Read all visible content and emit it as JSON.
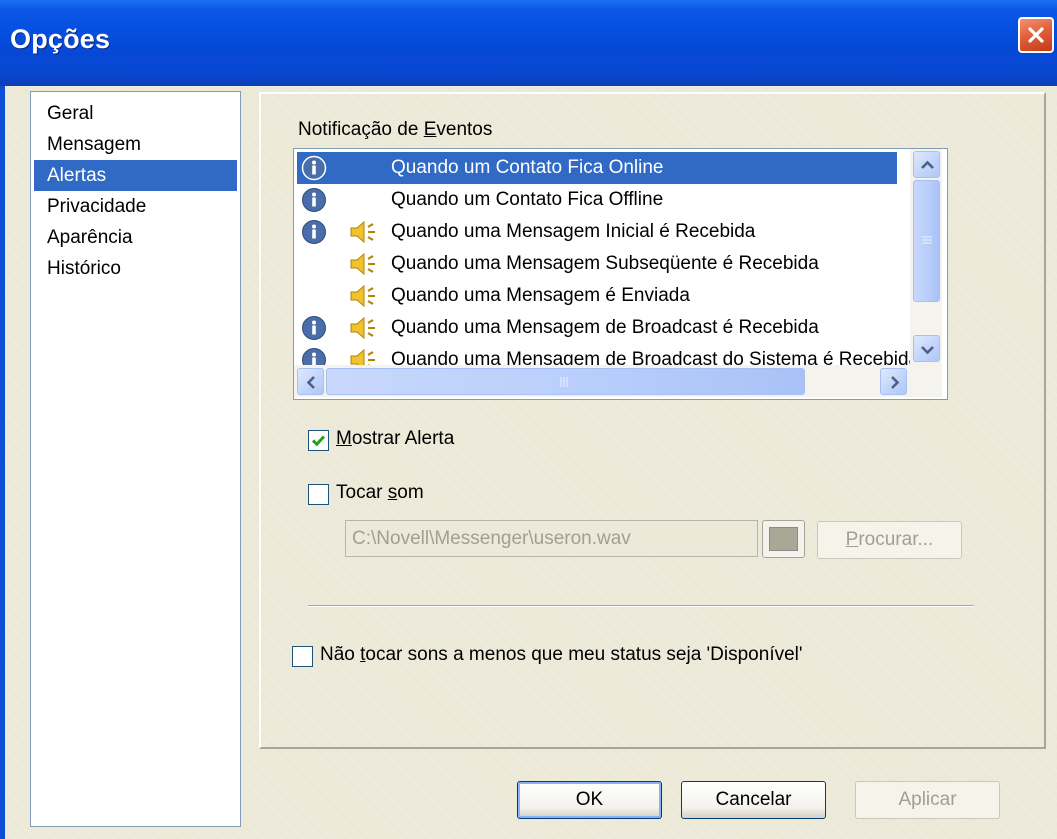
{
  "window": {
    "title": "Opções"
  },
  "nav": {
    "items": [
      {
        "label": "Geral",
        "selected": false
      },
      {
        "label": "Mensagem",
        "selected": false
      },
      {
        "label": "Alertas",
        "selected": true
      },
      {
        "label": "Privacidade",
        "selected": false
      },
      {
        "label": "Aparência",
        "selected": false
      },
      {
        "label": "Histórico",
        "selected": false
      }
    ]
  },
  "alerts": {
    "events_label_before": "Notificação de ",
    "events_label_accel": "E",
    "events_label_after": "ventos",
    "events": [
      {
        "text": "Quando um Contato Fica Online",
        "info_icon": true,
        "speaker_icon": false,
        "selected": true
      },
      {
        "text": "Quando um Contato Fica Offline",
        "info_icon": true,
        "speaker_icon": false,
        "selected": false
      },
      {
        "text": "Quando uma Mensagem Inicial é Recebida",
        "info_icon": true,
        "speaker_icon": true,
        "selected": false
      },
      {
        "text": "Quando uma Mensagem Subseqüente é Recebida",
        "info_icon": false,
        "speaker_icon": true,
        "selected": false
      },
      {
        "text": "Quando uma Mensagem é Enviada",
        "info_icon": false,
        "speaker_icon": true,
        "selected": false
      },
      {
        "text": "Quando uma Mensagem de Broadcast é Recebida",
        "info_icon": true,
        "speaker_icon": true,
        "selected": false
      },
      {
        "text": "Quando uma Mensagem de Broadcast do Sistema é Recebida",
        "info_icon": true,
        "speaker_icon": true,
        "selected": false
      }
    ],
    "show_alert": {
      "accel": "M",
      "rest": "ostrar Alerta",
      "checked": true
    },
    "play_sound": {
      "before": "Tocar ",
      "accel": "s",
      "after": "om",
      "checked": false
    },
    "sound_path": "C:\\Novell\\Messenger\\useron.wav",
    "browse": {
      "accel": "P",
      "rest": "rocurar..."
    },
    "no_sound_unless": {
      "before": "Não ",
      "accel": "t",
      "after": "ocar sons a menos que meu status seja 'Disponível'",
      "checked": false
    }
  },
  "buttons": {
    "ok": "OK",
    "cancel": "Cancelar",
    "apply": "Aplicar"
  },
  "icons": {
    "close": "close-icon",
    "info": "info-icon",
    "speaker": "speaker-icon",
    "check": "checkmark-icon"
  },
  "colors": {
    "title_bar": "#0a4fd6",
    "selection": "#316ac5",
    "dialog_bg": "#ece9d8",
    "close_button": "#e2603a",
    "checkmark": "#21a121"
  }
}
